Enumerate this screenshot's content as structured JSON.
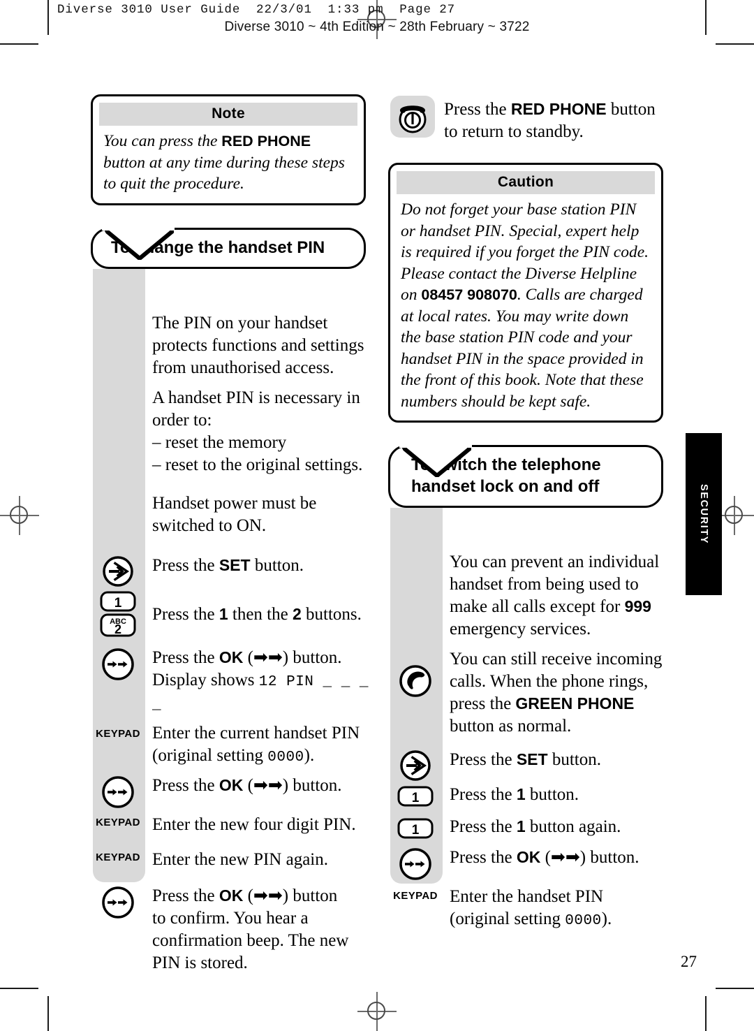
{
  "header": {
    "file_line": "Diverse 3010 User Guide  22/3/01  1:33 pm  Page 27",
    "edition_line": "Diverse 3010 ~ 4th Edition ~ 28th February ~ 3722"
  },
  "page_number": "27",
  "side_tab": {
    "label": "SECURITY"
  },
  "left_column": {
    "note_box": {
      "title": "Note",
      "body_parts": [
        {
          "text": "You can press the ",
          "bold": false
        },
        {
          "text": "RED PHONE",
          "bold": true
        },
        {
          "text": " button at any time during these steps to quit the procedure.",
          "bold": false
        }
      ]
    },
    "section": {
      "heading": "To change the handset PIN",
      "intro": [
        "The PIN on your handset protects functions and settings from unauthorised access.",
        "A handset PIN is necessary in order to:",
        "– reset the memory",
        "– reset to the original settings.",
        "Handset power must be switched to ON."
      ],
      "steps": [
        {
          "icon": "set-button-icon",
          "icon_label": "",
          "text_parts": [
            {
              "t": "Press the ",
              "b": false
            },
            {
              "t": "SET",
              "b": true
            },
            {
              "t": " button.",
              "b": false
            }
          ]
        },
        {
          "icon": "keypad-1-2-icon",
          "icon_label": "",
          "text_parts": [
            {
              "t": "Press the ",
              "b": false
            },
            {
              "t": "1",
              "b": true
            },
            {
              "t": " then the ",
              "b": false
            },
            {
              "t": "2",
              "b": true
            },
            {
              "t": " buttons.",
              "b": false
            }
          ]
        },
        {
          "icon": "ok-button-icon",
          "icon_label": "",
          "text_parts": [
            {
              "t": "Press the ",
              "b": false
            },
            {
              "t": "OK",
              "b": true
            },
            {
              "t": " (➡➡) button.",
              "b": false
            }
          ],
          "display_line": {
            "label": "Display shows ",
            "lcd": "12  PIN _ _ _ _"
          }
        },
        {
          "icon": "keypad-text-icon",
          "icon_label": "KEYPAD",
          "text_parts": [
            {
              "t": "Enter the current handset PIN (original setting ",
              "b": false
            }
          ],
          "lcd_tail": "0000",
          "text_tail": ")."
        },
        {
          "icon": "ok-button-icon",
          "icon_label": "",
          "text_parts": [
            {
              "t": "Press the ",
              "b": false
            },
            {
              "t": "OK",
              "b": true
            },
            {
              "t": " (➡➡) button.",
              "b": false
            }
          ]
        },
        {
          "icon": "keypad-text-icon",
          "icon_label": "KEYPAD",
          "text_parts": [
            {
              "t": "Enter the new four digit PIN.",
              "b": false
            }
          ]
        },
        {
          "icon": "keypad-text-icon",
          "icon_label": "KEYPAD",
          "text_parts": [
            {
              "t": "Enter the new PIN again.",
              "b": false
            }
          ]
        },
        {
          "icon": "ok-button-icon",
          "icon_label": "",
          "text_parts": [
            {
              "t": "Press the ",
              "b": false
            },
            {
              "t": "OK",
              "b": true
            },
            {
              "t": " (➡➡) button to confirm. You hear a confirmation beep.  The new PIN is stored.",
              "b": false
            }
          ]
        }
      ]
    }
  },
  "right_column": {
    "standby_step": {
      "icon": "red-phone-icon",
      "text_parts": [
        {
          "t": "Press the ",
          "b": false
        },
        {
          "t": "RED PHONE",
          "b": true
        },
        {
          "t": " button to return to standby.",
          "b": false
        }
      ]
    },
    "caution_box": {
      "title": "Caution",
      "body_parts": [
        {
          "text": "Do not forget your base station PIN or handset PIN. Special, expert help is required if you forget the PIN code. Please contact the Diverse Helpline on ",
          "bold": false
        },
        {
          "text": "08457 908070",
          "bold": true
        },
        {
          "text": ". Calls are charged at local rates. You may write down the base station PIN code and your handset PIN in the space provided in the front of this book. Note that these numbers should be kept safe.",
          "bold": false
        }
      ]
    },
    "section": {
      "heading_line1": "To switch the telephone",
      "heading_line2": "handset lock on and off",
      "intro_parts": [
        [
          {
            "t": "You can prevent an individual handset from being used to make all calls except for ",
            "b": false
          },
          {
            "t": "999",
            "b": true
          },
          {
            "t": " emergency services.",
            "b": false
          }
        ]
      ],
      "steps": [
        {
          "icon": "green-phone-icon",
          "icon_label": "",
          "text_parts": [
            {
              "t": "You can still receive incoming calls. When the phone rings, press the ",
              "b": false
            },
            {
              "t": "GREEN PHONE",
              "b": true
            },
            {
              "t": " button as normal.",
              "b": false
            }
          ]
        },
        {
          "icon": "set-button-icon",
          "icon_label": "",
          "text_parts": [
            {
              "t": "Press the ",
              "b": false
            },
            {
              "t": "SET",
              "b": true
            },
            {
              "t": " button.",
              "b": false
            }
          ]
        },
        {
          "icon": "keypad-1-icon",
          "icon_label": "",
          "text_parts": [
            {
              "t": "Press the ",
              "b": false
            },
            {
              "t": "1",
              "b": true
            },
            {
              "t": " button.",
              "b": false
            }
          ]
        },
        {
          "icon": "keypad-1-icon",
          "icon_label": "",
          "text_parts": [
            {
              "t": "Press the ",
              "b": false
            },
            {
              "t": "1",
              "b": true
            },
            {
              "t": " button again.",
              "b": false
            }
          ]
        },
        {
          "icon": "ok-button-icon",
          "icon_label": "",
          "text_parts": [
            {
              "t": "Press the ",
              "b": false
            },
            {
              "t": "OK",
              "b": true
            },
            {
              "t": " (➡➡) button.",
              "b": false
            }
          ]
        },
        {
          "icon": "keypad-text-icon",
          "icon_label": "KEYPAD",
          "text_parts": [
            {
              "t": "Enter the handset PIN (original setting ",
              "b": false
            }
          ],
          "lcd_tail": "0000",
          "text_tail": ")."
        }
      ]
    }
  },
  "keypad_keys": {
    "key_1": "1",
    "key_2": "2",
    "key_2_letters": "ABC"
  },
  "colors": {
    "grey_strip": "#d9d9d9",
    "box_title_bg": "#d9d9d9",
    "ink": "#000000",
    "tab_bg": "#000000"
  }
}
